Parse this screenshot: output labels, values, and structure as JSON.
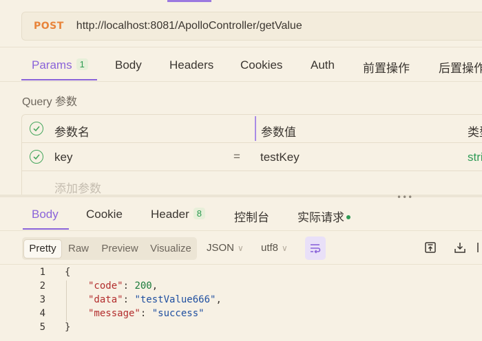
{
  "request": {
    "method": "POST",
    "url": "http://localhost:8081/ApolloController/getValue"
  },
  "request_tabs": [
    {
      "label": "Params",
      "badge": "1"
    },
    {
      "label": "Body"
    },
    {
      "label": "Headers"
    },
    {
      "label": "Cookies"
    },
    {
      "label": "Auth"
    },
    {
      "label": "前置操作"
    },
    {
      "label": "后置操作"
    }
  ],
  "params": {
    "section_label": "Query 参数",
    "headers": {
      "name": "参数名",
      "value": "参数值",
      "type": "类型"
    },
    "rows": [
      {
        "name": "key",
        "equals": "=",
        "value": "testKey",
        "type": "string"
      }
    ],
    "add_placeholder": "添加参数"
  },
  "response_tabs": [
    {
      "label": "Body"
    },
    {
      "label": "Cookie"
    },
    {
      "label": "Header",
      "badge": "8"
    },
    {
      "label": "控制台"
    },
    {
      "label": "实际请求"
    }
  ],
  "response_toolbar": {
    "views": [
      "Pretty",
      "Raw",
      "Preview",
      "Visualize"
    ],
    "format": "JSON",
    "encoding": "utf8"
  },
  "response_body": {
    "line_numbers": [
      "1",
      "2",
      "3",
      "4",
      "5"
    ],
    "open_brace": "{",
    "close_brace": "}",
    "fields": [
      {
        "key": "\"code\"",
        "value": "200",
        "trail": ","
      },
      {
        "key": "\"data\"",
        "value": "\"testValue666\"",
        "trail": ","
      },
      {
        "key": "\"message\"",
        "value": "\"success\"",
        "trail": ""
      }
    ]
  },
  "colors": {
    "accent": "#8a63d9",
    "method": "#e8843a",
    "success": "#2e9a55",
    "background": "#f7f1e4"
  }
}
